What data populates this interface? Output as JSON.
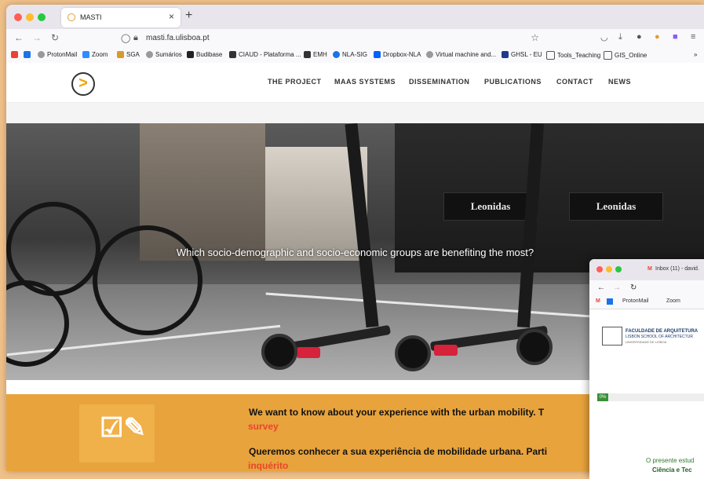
{
  "browser": {
    "tab_title": "MASTI",
    "url": "masti.fa.ulisboa.pt",
    "new_tab": "+",
    "close": "×",
    "bookmarks": [
      "ProtonMail",
      "Zoom",
      "SGA",
      "Sumários",
      "Budibase",
      "CIAUD - Plataforma ...",
      "EMH",
      "NLA-SIG",
      "Dropbox-NLA",
      "Virtual machine and...",
      "GHSL - EU",
      "Tools_Teaching",
      "GIS_Online"
    ],
    "overflow": "»"
  },
  "site": {
    "logo": ">",
    "nav": [
      "THE PROJECT",
      "MAAS SYSTEMS",
      "DISSEMINATION",
      "PUBLICATIONS",
      "CONTACT",
      "NEWS"
    ],
    "hero_question": "Which socio-demographic and socio-economic groups are benefiting the most?",
    "shop_sign": "Leonidas",
    "survey": {
      "line1": "We want to know about your experience with the urban mobility. T",
      "link1": "survey",
      "line2": "Queremos conhecer a sua experiência de mobilidade urbana. Parti",
      "link2": "inquérito"
    }
  },
  "popup": {
    "tab_title": "Inbox (11) - david.",
    "bookmarks": [
      "ProtonMail",
      "Zoom"
    ],
    "faculty": "FACULDADE DE ARQUITETURA",
    "school": "LISBON SCHOOL OF ARCHITECTUR",
    "university": "UNIVERSIDADE DE LISBOA",
    "progress_label": "0%",
    "progress": 0,
    "intro": "O presente estud",
    "intro2": "Ciência e Tec"
  },
  "colors": {
    "accent": "#e8a33c",
    "link_red": "#e8452c",
    "logo_orange": "#f2a200"
  }
}
